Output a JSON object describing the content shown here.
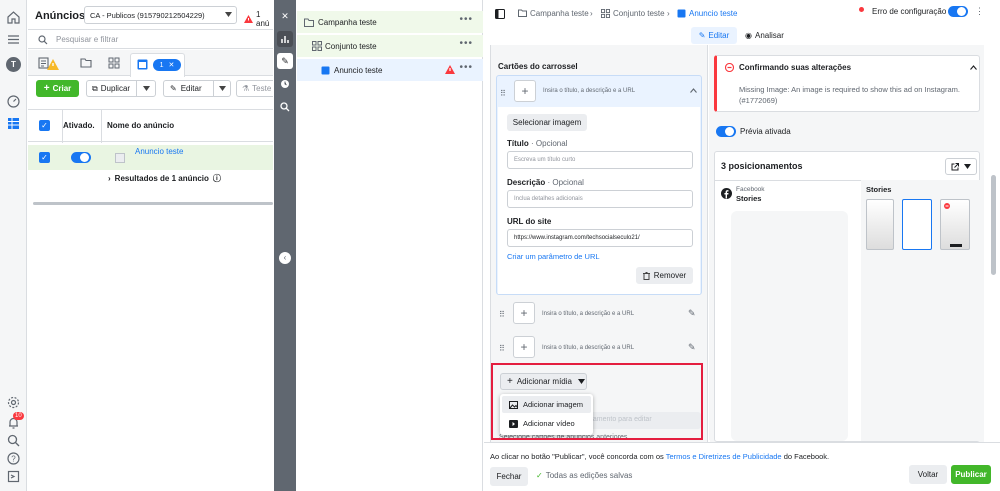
{
  "ads_manager": {
    "title": "Anúncios",
    "account": "CA - Publicos (915790212504229)",
    "warn_text": "1 anú",
    "search_placeholder": "Pesquisar e filtrar",
    "tab_count": "1",
    "create_label": "Criar",
    "duplicate_label": "Duplicar",
    "edit_label": "Editar",
    "test_label": "Teste",
    "col_active": "Ativado.",
    "col_name": "Nome do anúncio",
    "row_ad_name": "Anuncio teste",
    "results_label": "Resultados de 1 anúncio"
  },
  "left_nav": {
    "notif_count": "10"
  },
  "tree": {
    "campaign": "Campanha teste",
    "adset": "Conjunto teste",
    "ad": "Anuncio teste"
  },
  "editor": {
    "crumbs": [
      "Campanha teste",
      "Conjunto teste",
      "Anuncio teste"
    ],
    "config_error": "Erro de configuração",
    "tab_edit": "Editar",
    "tab_analyze": "Analisar",
    "carousel_title": "Cartões do carrossel",
    "card_desc": "Insira o título, a descrição e a URL",
    "select_image": "Selecionar imagem",
    "title_label": "Título",
    "optional": "· Opcional",
    "title_placeholder": "Escreva um título curto",
    "desc_label": "Descrição",
    "desc_placeholder": "Inclua detalhes adicionais",
    "url_label": "URL do site",
    "url_value": "https://www.instagram.com/techsocialseculo21/",
    "url_param_link": "Criar um parâmetro de URL",
    "remove_label": "Remover",
    "add_media": "Adicionar mídia",
    "add_image": "Adicionar imagem",
    "add_video": "Adicionar vídeo",
    "hidden_select": "namento para editar",
    "hidden_text": "Selecione cartões de anúncios anteriores",
    "footer_notice_1": "Ao clicar no botão \"Publicar\", você concorda com os",
    "footer_link": "Termos e Diretrizes de Publicidade",
    "footer_notice_2": "do Facebook.",
    "close_label": "Fechar",
    "saved_label": "Todas as edições salvas",
    "back_label": "Voltar",
    "publish_label": "Publicar"
  },
  "preview": {
    "error_title": "Confirmando suas alterações",
    "error_msg": "Missing Image: An image is required to show this ad on Instagram. (#1772069)",
    "preview_toggle": "Prévia ativada",
    "placements": "3 posicionamentos",
    "fb_label": "Facebook",
    "fb_stories": "Stories",
    "stories_label": "Stories"
  },
  "colors": {
    "accent": "#1877f2",
    "green": "#42b72a",
    "error": "#fa383e",
    "highlight": "#e41e3f"
  }
}
